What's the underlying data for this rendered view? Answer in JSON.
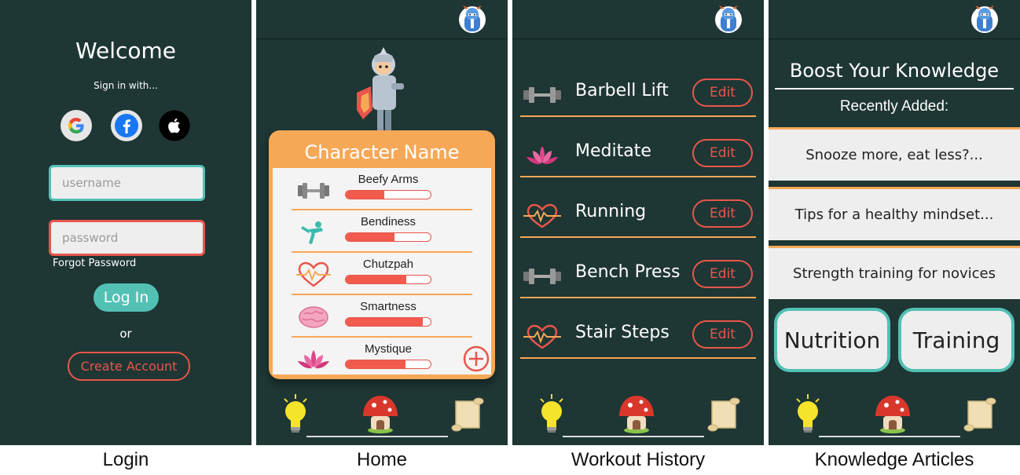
{
  "login": {
    "title": "Welcome",
    "subtitle": "Sign in with...",
    "username_placeholder": "username",
    "password_placeholder": "password",
    "forgot_password": "Forgot Password",
    "login_button": "Log In",
    "or": "or",
    "create_account": "Create Account",
    "social_icons": [
      "google-icon",
      "facebook-icon",
      "apple-icon"
    ]
  },
  "home": {
    "character_name": "Character Name",
    "stats": [
      {
        "label": "Beefy Arms",
        "level": 0.45,
        "icon": "barbell-icon"
      },
      {
        "label": "Bendiness",
        "level": 0.57,
        "icon": "stretch-icon"
      },
      {
        "label": "Chutzpah",
        "level": 0.71,
        "icon": "heart-icon"
      },
      {
        "label": "Smartness",
        "level": 0.91,
        "icon": "brain-icon"
      },
      {
        "label": "Mystique",
        "level": 0.7,
        "icon": "lotus-icon"
      }
    ]
  },
  "workout": {
    "items": [
      {
        "label": "Barbell Lift",
        "edit": "Edit",
        "icon": "barbell-icon"
      },
      {
        "label": "Meditate",
        "edit": "Edit",
        "icon": "lotus-icon"
      },
      {
        "label": "Running",
        "edit": "Edit",
        "icon": "heart-icon"
      },
      {
        "label": "Bench Press",
        "edit": "Edit",
        "icon": "barbell-icon"
      },
      {
        "label": "Stair Steps",
        "edit": "Edit",
        "icon": "heart-icon"
      }
    ]
  },
  "knowledge": {
    "title": "Boost Your Knowledge",
    "subtitle": "Recently Added:",
    "articles": [
      "Snooze more, eat less?...",
      "Tips for a healthy mindset...",
      "Strength training for novices"
    ],
    "categories": [
      "Nutrition",
      "Training"
    ]
  },
  "captions": [
    "Login",
    "Home",
    "Workout History",
    "Knowledge Articles"
  ],
  "colors": {
    "background": "#1e3634",
    "accent_orange": "#f7a857",
    "accent_red": "#e8564b",
    "accent_teal": "#53c0b4"
  }
}
